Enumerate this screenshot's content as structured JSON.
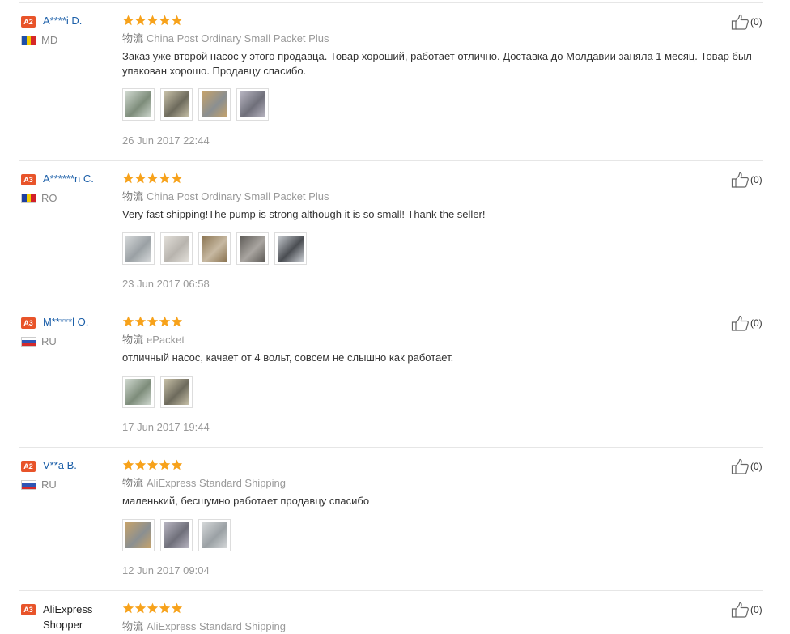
{
  "ship_prefix": "物流",
  "colors": {
    "accent_link": "#1a5ea8",
    "star": "#f7a21b",
    "badge": "#e8542a"
  },
  "reviews": [
    {
      "level": "A2",
      "name": "A****i D.",
      "country": "MD",
      "flag": "moldova-flag-icon",
      "rating": 5,
      "shipping": "China Post Ordinary Small Packet Plus",
      "text": "Заказ уже второй насос у этого продавца. Товар хороший, работает отлично. Доставка до Молдавии заняла 1 месяц. Товар был упакован хорошо. Продавцу спасибо.",
      "photos": 4,
      "date": "26 Jun 2017 22:44",
      "helpful": "(0)"
    },
    {
      "level": "A3",
      "name": "A******n C.",
      "country": "RO",
      "flag": "romania-flag-icon",
      "rating": 5,
      "shipping": "China Post Ordinary Small Packet Plus",
      "text": "Very fast shipping!The pump is strong although it is so small! Thank the seller!",
      "photos": 5,
      "date": "23 Jun 2017 06:58",
      "helpful": "(0)"
    },
    {
      "level": "A3",
      "name": "M*****l O.",
      "country": "RU",
      "flag": "russia-flag-icon",
      "rating": 5,
      "shipping": "ePacket",
      "text": "отличный насос, качает от 4 вольт, совсем не слышно как работает.",
      "photos": 2,
      "date": "17 Jun 2017 19:44",
      "helpful": "(0)"
    },
    {
      "level": "A2",
      "name": "V**a B.",
      "country": "RU",
      "flag": "russia-flag-icon",
      "rating": 5,
      "shipping": "AliExpress Standard Shipping",
      "text": "маленький, бесшумно работает продавцу спасибо",
      "photos": 3,
      "date": "12 Jun 2017 09:04",
      "helpful": "(0)"
    },
    {
      "level": "A3",
      "name": "AliExpress Shopper",
      "country": "",
      "flag": "",
      "rating": 5,
      "shipping": "AliExpress Standard Shipping",
      "text": "",
      "photos": 0,
      "date": "",
      "helpful": "(0)"
    }
  ]
}
